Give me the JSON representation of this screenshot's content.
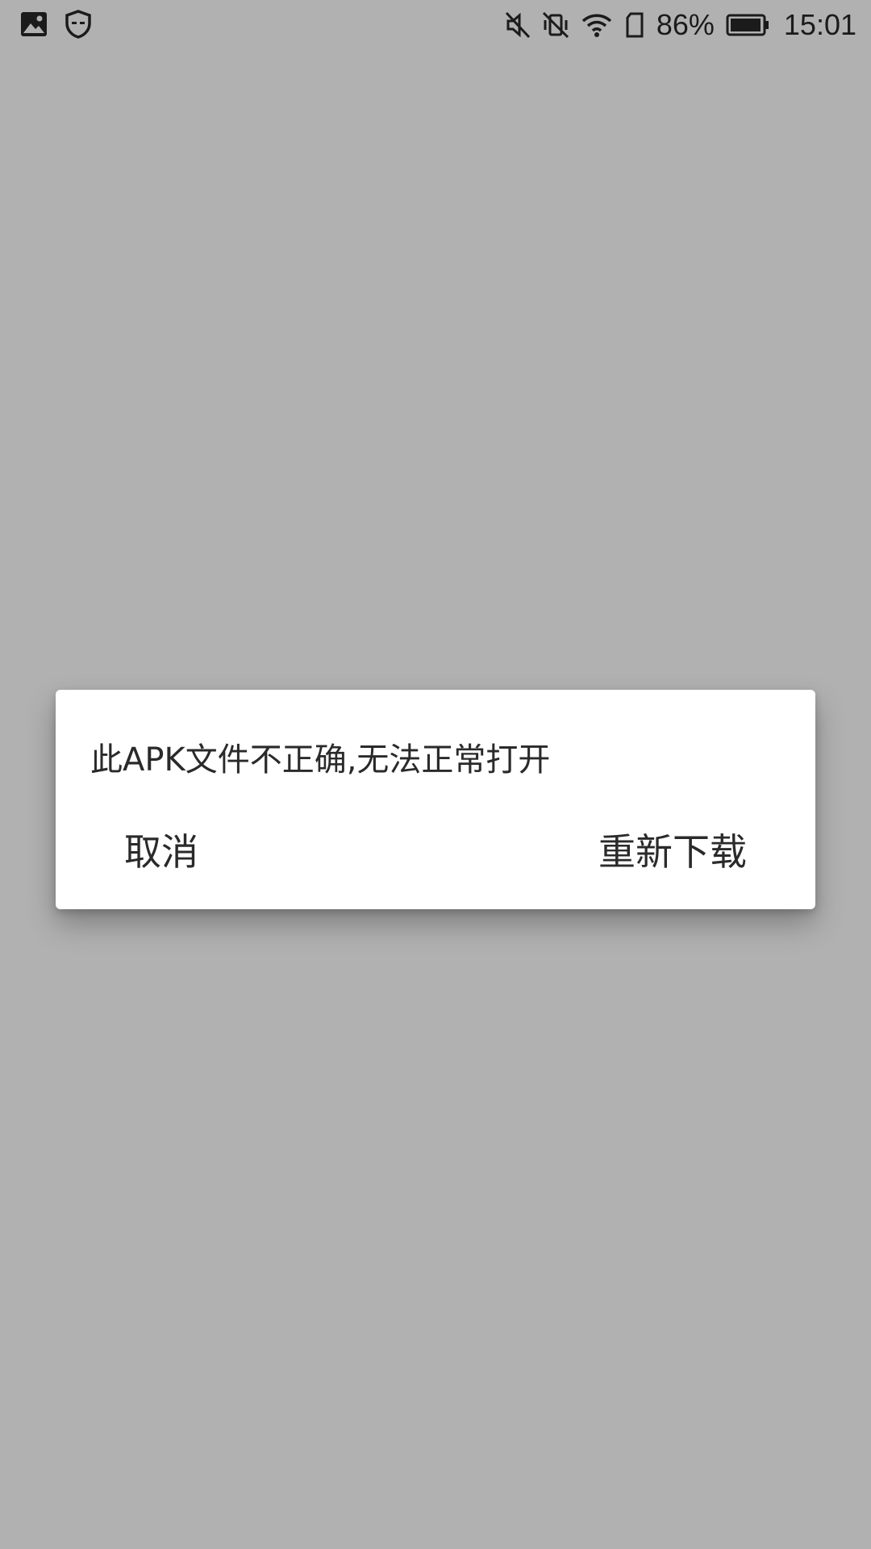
{
  "status_bar": {
    "left_icons": [
      "image-icon",
      "shield-icon"
    ],
    "right_icons": [
      "mute-icon",
      "vibrate-off-icon",
      "wifi-icon",
      "sim-icon"
    ],
    "battery_percent": "86%",
    "time": "15:01"
  },
  "dialog": {
    "message": "此APK文件不正确,无法正常打开",
    "cancel_label": "取消",
    "redownload_label": "重新下载"
  },
  "colors": {
    "scrim": "#b1b1b1",
    "dialog_bg": "#ffffff",
    "text": "#2a2a2a"
  }
}
